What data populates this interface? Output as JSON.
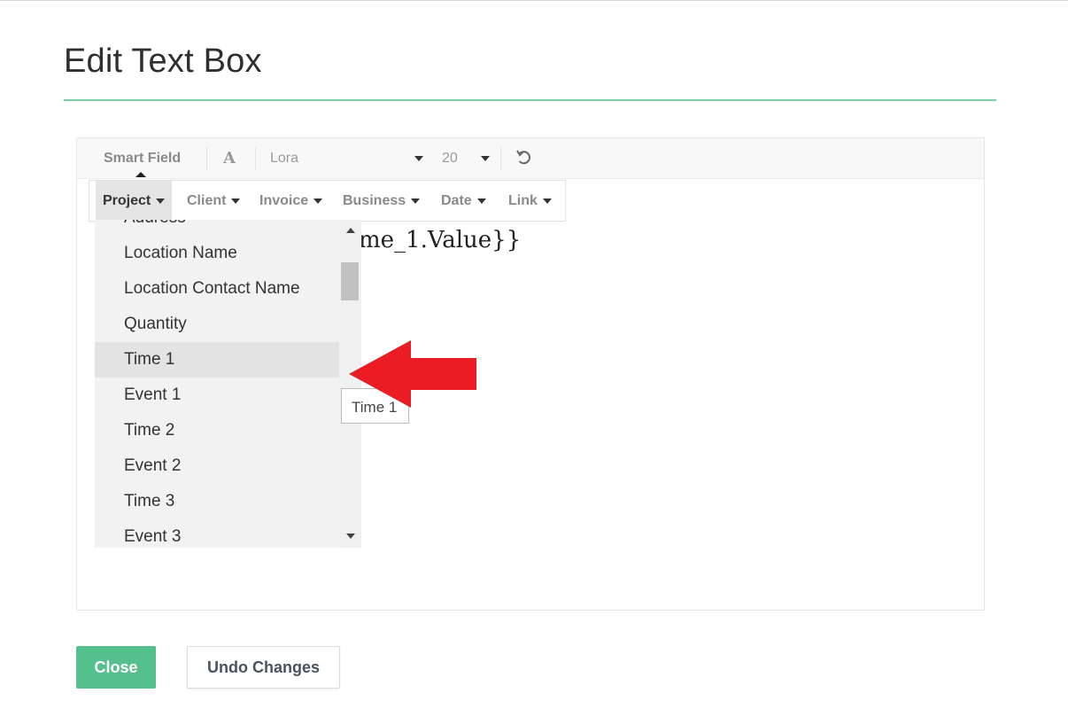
{
  "dialog": {
    "title": "Edit Text Box"
  },
  "toolbar": {
    "smart_field_label": "Smart Field",
    "font_icon_glyph": "A",
    "font_family": "Lora",
    "font_size": "20",
    "undo_icon": "undo-icon"
  },
  "editor": {
    "content_visible": "me_1.Value}}"
  },
  "smart_menu": {
    "tabs": [
      {
        "label": "Project",
        "active": true
      },
      {
        "label": "Client"
      },
      {
        "label": "Invoice"
      },
      {
        "label": "Business"
      },
      {
        "label": "Date"
      },
      {
        "label": "Link"
      }
    ],
    "items": [
      "Address",
      "Location Name",
      "Location Contact Name",
      "Quantity",
      "Time 1",
      "Event 1",
      "Time 2",
      "Event 2",
      "Time 3",
      "Event 3"
    ],
    "hovered_item": "Time 1",
    "tooltip": "Time 1"
  },
  "annotation": {
    "arrow_color": "#ec1c24"
  },
  "footer": {
    "close_label": "Close",
    "undo_label": "Undo Changes"
  },
  "colors": {
    "accent": "#55c08d",
    "title_rule": "#7dcca6"
  }
}
